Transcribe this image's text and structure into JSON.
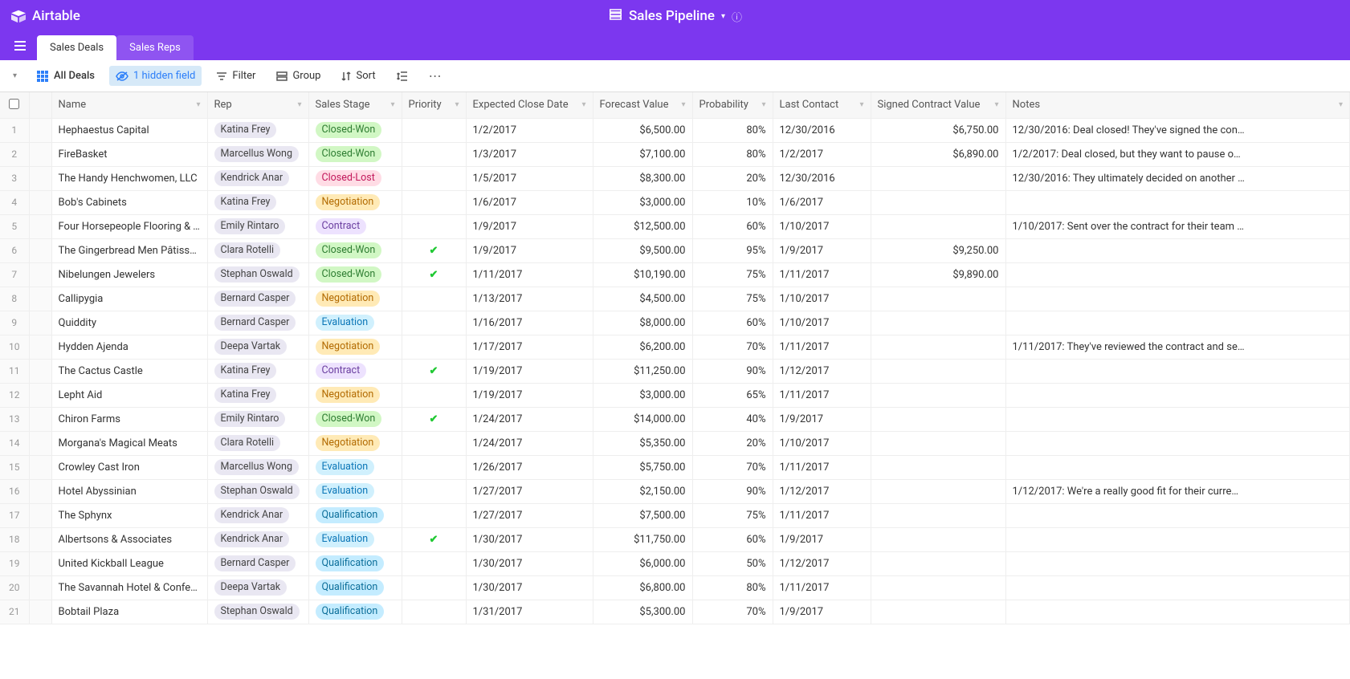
{
  "app": {
    "name": "Airtable",
    "base_title": "Sales Pipeline"
  },
  "tabs": [
    {
      "label": "Sales Deals",
      "active": true
    },
    {
      "label": "Sales Reps",
      "active": false
    }
  ],
  "toolbar": {
    "view_name": "All Deals",
    "hidden_fields": "1 hidden field",
    "filter": "Filter",
    "group": "Group",
    "sort": "Sort"
  },
  "columns": [
    {
      "key": "name",
      "label": "Name"
    },
    {
      "key": "rep",
      "label": "Rep"
    },
    {
      "key": "stage",
      "label": "Sales Stage"
    },
    {
      "key": "priority",
      "label": "Priority"
    },
    {
      "key": "expected_close",
      "label": "Expected Close Date"
    },
    {
      "key": "forecast",
      "label": "Forecast Value"
    },
    {
      "key": "probability",
      "label": "Probability"
    },
    {
      "key": "last_contact",
      "label": "Last Contact"
    },
    {
      "key": "signed",
      "label": "Signed Contract Value"
    },
    {
      "key": "notes",
      "label": "Notes"
    }
  ],
  "rows": [
    {
      "n": 1,
      "name": "Hephaestus Capital",
      "rep": "Katina Frey",
      "stage": "Closed-Won",
      "priority": false,
      "expected_close": "1/2/2017",
      "forecast": "$6,500.00",
      "probability": "80%",
      "last_contact": "12/30/2016",
      "signed": "$6,750.00",
      "notes": "12/30/2016: Deal closed! They've signed the con…"
    },
    {
      "n": 2,
      "name": "FireBasket",
      "rep": "Marcellus Wong",
      "stage": "Closed-Won",
      "priority": false,
      "expected_close": "1/3/2017",
      "forecast": "$7,100.00",
      "probability": "80%",
      "last_contact": "1/2/2017",
      "signed": "$6,890.00",
      "notes": "1/2/2017: Deal closed, but they want to pause o…"
    },
    {
      "n": 3,
      "name": "The Handy Henchwomen, LLC",
      "rep": "Kendrick Anar",
      "stage": "Closed-Lost",
      "priority": false,
      "expected_close": "1/5/2017",
      "forecast": "$8,300.00",
      "probability": "20%",
      "last_contact": "12/30/2016",
      "signed": "",
      "notes": "12/30/2016: They ultimately decided on another …"
    },
    {
      "n": 4,
      "name": "Bob's Cabinets",
      "rep": "Katina Frey",
      "stage": "Negotiation",
      "priority": false,
      "expected_close": "1/6/2017",
      "forecast": "$3,000.00",
      "probability": "10%",
      "last_contact": "1/6/2017",
      "signed": "",
      "notes": ""
    },
    {
      "n": 5,
      "name": "Four Horsepeople Flooring & Tile",
      "rep": "Emily Rintaro",
      "stage": "Contract",
      "priority": false,
      "expected_close": "1/9/2017",
      "forecast": "$12,500.00",
      "probability": "60%",
      "last_contact": "1/10/2017",
      "signed": "",
      "notes": "1/10/2017: Sent over the contract for their team …"
    },
    {
      "n": 6,
      "name": "The Gingerbread Men Pâtisserie",
      "rep": "Clara Rotelli",
      "stage": "Closed-Won",
      "priority": true,
      "expected_close": "1/9/2017",
      "forecast": "$9,500.00",
      "probability": "95%",
      "last_contact": "1/9/2017",
      "signed": "$9,250.00",
      "notes": ""
    },
    {
      "n": 7,
      "name": "Nibelungen Jewelers",
      "rep": "Stephan Oswald",
      "stage": "Closed-Won",
      "priority": true,
      "expected_close": "1/11/2017",
      "forecast": "$10,190.00",
      "probability": "75%",
      "last_contact": "1/11/2017",
      "signed": "$9,890.00",
      "notes": ""
    },
    {
      "n": 8,
      "name": "Callipygia",
      "rep": "Bernard Casper",
      "stage": "Negotiation",
      "priority": false,
      "expected_close": "1/13/2017",
      "forecast": "$4,500.00",
      "probability": "75%",
      "last_contact": "1/10/2017",
      "signed": "",
      "notes": ""
    },
    {
      "n": 9,
      "name": "Quiddity",
      "rep": "Bernard Casper",
      "stage": "Evaluation",
      "priority": false,
      "expected_close": "1/16/2017",
      "forecast": "$8,000.00",
      "probability": "60%",
      "last_contact": "1/10/2017",
      "signed": "",
      "notes": ""
    },
    {
      "n": 10,
      "name": "Hydden Ajenda",
      "rep": "Deepa Vartak",
      "stage": "Negotiation",
      "priority": false,
      "expected_close": "1/17/2017",
      "forecast": "$6,200.00",
      "probability": "70%",
      "last_contact": "1/11/2017",
      "signed": "",
      "notes": "1/11/2017: They've reviewed the contract and se…"
    },
    {
      "n": 11,
      "name": "The Cactus Castle",
      "rep": "Katina Frey",
      "stage": "Contract",
      "priority": true,
      "expected_close": "1/19/2017",
      "forecast": "$11,250.00",
      "probability": "90%",
      "last_contact": "1/12/2017",
      "signed": "",
      "notes": ""
    },
    {
      "n": 12,
      "name": "Lepht Aid",
      "rep": "Katina Frey",
      "stage": "Negotiation",
      "priority": false,
      "expected_close": "1/19/2017",
      "forecast": "$3,000.00",
      "probability": "65%",
      "last_contact": "1/11/2017",
      "signed": "",
      "notes": ""
    },
    {
      "n": 13,
      "name": "Chiron Farms",
      "rep": "Emily Rintaro",
      "stage": "Closed-Won",
      "priority": true,
      "expected_close": "1/24/2017",
      "forecast": "$14,000.00",
      "probability": "40%",
      "last_contact": "1/9/2017",
      "signed": "",
      "notes": ""
    },
    {
      "n": 14,
      "name": "Morgana's Magical Meats",
      "rep": "Clara Rotelli",
      "stage": "Negotiation",
      "priority": false,
      "expected_close": "1/24/2017",
      "forecast": "$5,350.00",
      "probability": "20%",
      "last_contact": "1/10/2017",
      "signed": "",
      "notes": ""
    },
    {
      "n": 15,
      "name": "Crowley Cast Iron",
      "rep": "Marcellus Wong",
      "stage": "Evaluation",
      "priority": false,
      "expected_close": "1/26/2017",
      "forecast": "$5,750.00",
      "probability": "70%",
      "last_contact": "1/11/2017",
      "signed": "",
      "notes": ""
    },
    {
      "n": 16,
      "name": "Hotel Abyssinian",
      "rep": "Stephan Oswald",
      "stage": "Evaluation",
      "priority": false,
      "expected_close": "1/27/2017",
      "forecast": "$2,150.00",
      "probability": "90%",
      "last_contact": "1/12/2017",
      "signed": "",
      "notes": "1/12/2017: We're a really good fit for their curre…"
    },
    {
      "n": 17,
      "name": "The Sphynx",
      "rep": "Kendrick Anar",
      "stage": "Qualification",
      "priority": false,
      "expected_close": "1/27/2017",
      "forecast": "$7,500.00",
      "probability": "75%",
      "last_contact": "1/11/2017",
      "signed": "",
      "notes": ""
    },
    {
      "n": 18,
      "name": "Albertsons & Associates",
      "rep": "Kendrick Anar",
      "stage": "Evaluation",
      "priority": true,
      "expected_close": "1/30/2017",
      "forecast": "$11,750.00",
      "probability": "60%",
      "last_contact": "1/9/2017",
      "signed": "",
      "notes": ""
    },
    {
      "n": 19,
      "name": "United Kickball League",
      "rep": "Bernard Casper",
      "stage": "Qualification",
      "priority": false,
      "expected_close": "1/30/2017",
      "forecast": "$6,000.00",
      "probability": "50%",
      "last_contact": "1/12/2017",
      "signed": "",
      "notes": ""
    },
    {
      "n": 20,
      "name": "The Savannah Hotel & Conferenc…",
      "rep": "Deepa Vartak",
      "stage": "Qualification",
      "priority": false,
      "expected_close": "1/30/2017",
      "forecast": "$6,800.00",
      "probability": "80%",
      "last_contact": "1/11/2017",
      "signed": "",
      "notes": ""
    },
    {
      "n": 21,
      "name": "Bobtail Plaza",
      "rep": "Stephan Oswald",
      "stage": "Qualification",
      "priority": false,
      "expected_close": "1/31/2017",
      "forecast": "$5,300.00",
      "probability": "70%",
      "last_contact": "1/9/2017",
      "signed": "",
      "notes": ""
    }
  ],
  "stage_styles": {
    "Closed-Won": "stage-closed-won",
    "Closed-Lost": "stage-closed-lost",
    "Negotiation": "stage-negotiation",
    "Contract": "stage-contract",
    "Evaluation": "stage-evaluation",
    "Qualification": "stage-qualification"
  }
}
